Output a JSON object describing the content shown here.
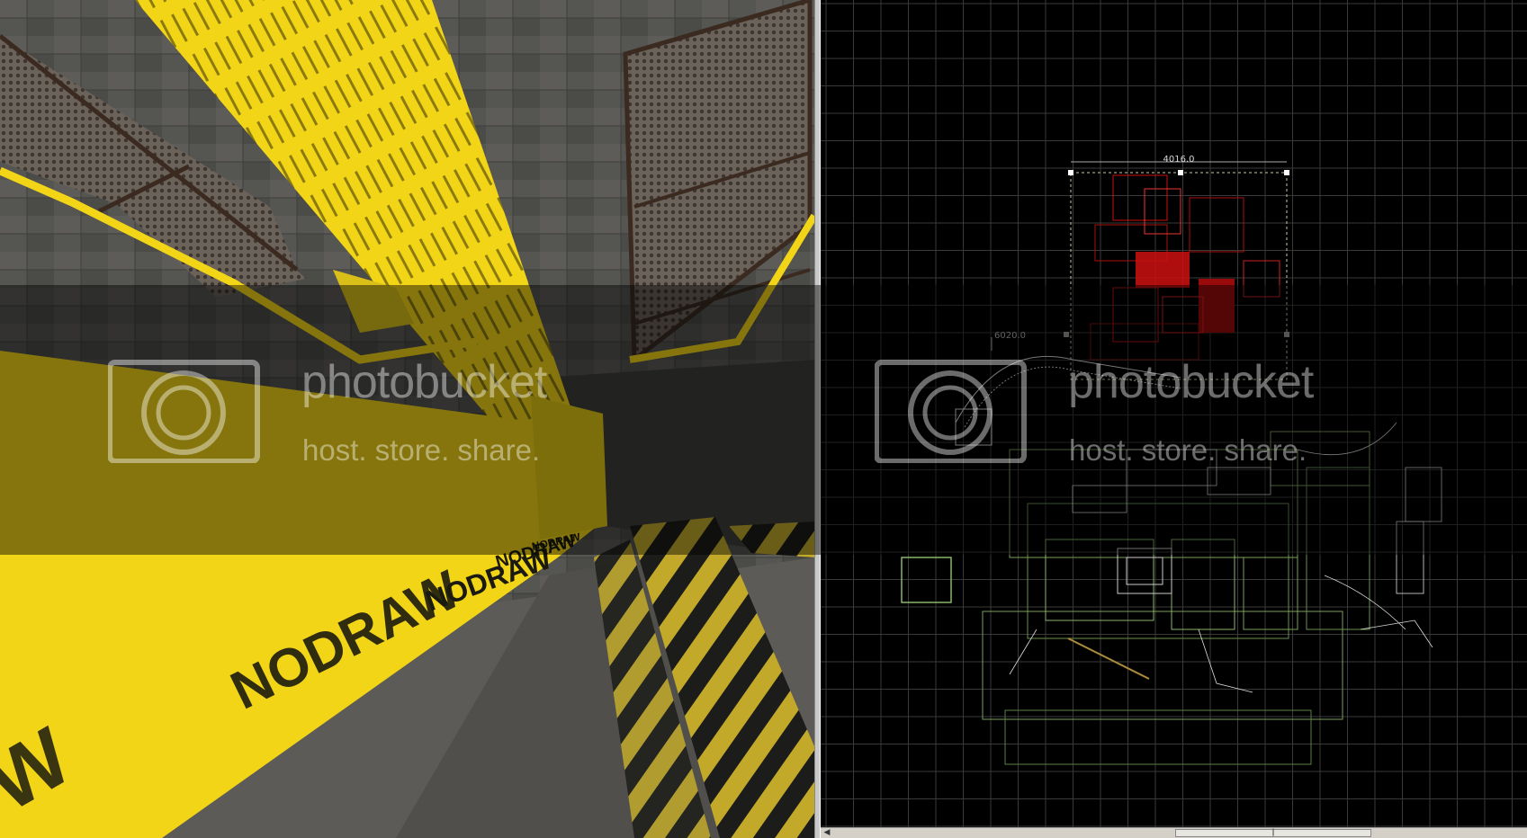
{
  "viewport_3d": {
    "nodraw_texts": [
      "NODRAW",
      "NODRAW",
      "NODRAW",
      "NODRAW",
      "W"
    ]
  },
  "viewport_2d": {
    "dimension_width": "4016.0",
    "dimension_height": "6020.0"
  },
  "watermark": {
    "brand": "photobucket",
    "tagline": "host. store. share."
  },
  "colors": {
    "nodraw_yellow": "#f2d517",
    "grid_line": "#3a3a3a",
    "selection_red": "#cc1111",
    "brush_green": "#7aa05a"
  }
}
